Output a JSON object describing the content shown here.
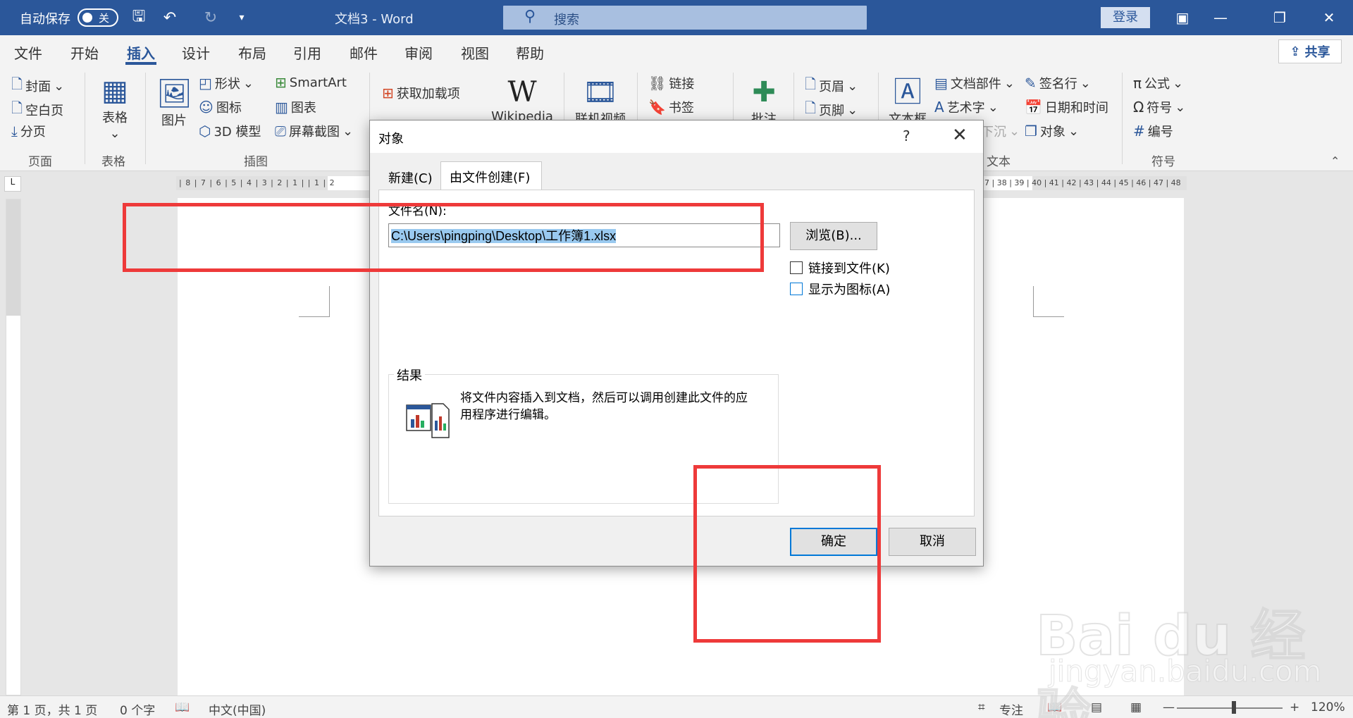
{
  "titlebar": {
    "autosave_label": "自动保存",
    "autosave_state": "关",
    "doc_title": "文档3  -  Word",
    "search_placeholder": "搜索",
    "login_label": "登录"
  },
  "ribbon_tabs": [
    "文件",
    "开始",
    "插入",
    "设计",
    "布局",
    "引用",
    "邮件",
    "审阅",
    "视图",
    "帮助"
  ],
  "active_tab": "插入",
  "share_label": "共享",
  "ribbon": {
    "pages": {
      "cover": "封面",
      "blank": "空白页",
      "break": "分页",
      "group": "页面"
    },
    "tables": {
      "table": "表格",
      "group": "表格"
    },
    "illustrations": {
      "picture": "图片",
      "shapes": "形状",
      "icons": "图标",
      "model3d": "3D 模型",
      "smartart": "SmartArt",
      "chart": "图表",
      "screenshot": "屏幕截图",
      "group": "插图"
    },
    "addins": {
      "get": "获取加载项",
      "wiki": "Wikipedia"
    },
    "media": {
      "video": "联机视频"
    },
    "links": {
      "link": "链接",
      "bookmark": "书签"
    },
    "comments": {
      "comment": "批注"
    },
    "header_footer": {
      "header": "页眉",
      "footer": "页脚"
    },
    "text": {
      "textbox": "文本框",
      "parts": "文档部件",
      "wordart": "艺术字",
      "dropcap": "下沉",
      "sigline": "签名行",
      "datetime": "日期和时间",
      "object": "对象",
      "group": "文本"
    },
    "symbols": {
      "equation": "公式",
      "symbol": "符号",
      "number": "编号",
      "group": "符号"
    }
  },
  "ruler": {
    "left_ticks": "| 8 | 7 | 6 | 5 | 4 | 3 | 2 | 1 |      | 1 | 2",
    "right_ticks": "37 | 38 | 39 | 40 | 41 | 42 | 43 | 44 | 45 | 46 | 47 | 48"
  },
  "dialog": {
    "title": "对象",
    "help": "?",
    "tabs": [
      "新建(C)",
      "由文件创建(F)"
    ],
    "filename_label": "文件名(N):",
    "filename_value": "C:\\Users\\pingping\\Desktop\\工作簿1.xlsx",
    "browse_label": "浏览(B)...",
    "link_checkbox": "链接到文件(K)",
    "icon_checkbox": "显示为图标(A)",
    "result_label": "结果",
    "result_text": "将文件内容插入到文档，然后可以调用创建此文件的应用程序进行编辑。",
    "ok_label": "确定",
    "cancel_label": "取消"
  },
  "statusbar": {
    "page": "第 1 页，共 1 页",
    "words": "0 个字",
    "language": "中文(中国)",
    "focus": "专注",
    "zoom": "120%"
  },
  "watermark": {
    "main": "Bai du 经验",
    "sub": "jingyan.baidu.com"
  }
}
